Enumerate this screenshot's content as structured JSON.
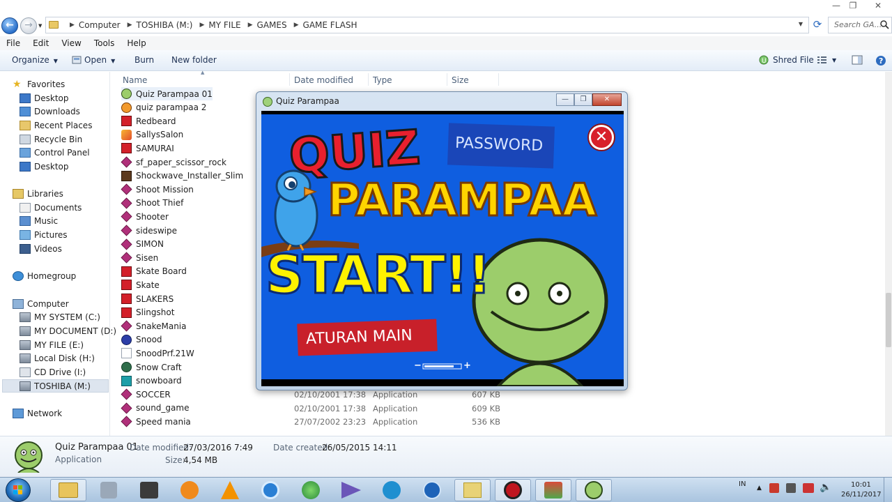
{
  "window": {
    "minimize": "—",
    "restore": "❐",
    "close": "✕"
  },
  "address": {
    "crumbs": [
      "Computer",
      "TOSHIBA (M:)",
      "MY FILE",
      "GAMES",
      "GAME FLASH"
    ],
    "search_placeholder": "Search GA..."
  },
  "menu": [
    "File",
    "Edit",
    "View",
    "Tools",
    "Help"
  ],
  "toolbar": {
    "organize": "Organize",
    "open": "Open",
    "burn": "Burn",
    "new_folder": "New folder",
    "shred": "Shred File"
  },
  "nav": {
    "favorites": "Favorites",
    "fav_items": [
      "Desktop",
      "Downloads",
      "Recent Places",
      "Recycle Bin",
      "Control Panel",
      "Desktop"
    ],
    "libraries": "Libraries",
    "lib_items": [
      "Documents",
      "Music",
      "Pictures",
      "Videos"
    ],
    "homegroup": "Homegroup",
    "computer": "Computer",
    "drives": [
      "MY SYSTEM (C:)",
      "MY DOCUMENT (D:)",
      "MY FILE (E:)",
      "Local Disk (H:)",
      "CD Drive (I:)",
      "TOSHIBA (M:)"
    ],
    "network": "Network"
  },
  "columns": {
    "name": "Name",
    "date": "Date modified",
    "type": "Type",
    "size": "Size"
  },
  "files": [
    {
      "name": "Quiz Parampaa 01",
      "icon": "green-face"
    },
    {
      "name": "quiz parampaa 2",
      "icon": "orange-face"
    },
    {
      "name": "Redbeard",
      "icon": "red-m"
    },
    {
      "name": "SallysSalon",
      "icon": "flash"
    },
    {
      "name": "SAMURAI",
      "icon": "red-m"
    },
    {
      "name": "sf_paper_scissor_rock",
      "icon": "diamond"
    },
    {
      "name": "Shockwave_Installer_Slim",
      "icon": "shockwave"
    },
    {
      "name": "Shoot Mission",
      "icon": "diamond"
    },
    {
      "name": "Shoot Thief",
      "icon": "diamond"
    },
    {
      "name": "Shooter",
      "icon": "diamond"
    },
    {
      "name": "sideswipe",
      "icon": "diamond"
    },
    {
      "name": "SIMON",
      "icon": "diamond"
    },
    {
      "name": "Sisen",
      "icon": "diamond"
    },
    {
      "name": "Skate Board",
      "icon": "red-m"
    },
    {
      "name": "Skate",
      "icon": "red-m"
    },
    {
      "name": "SLAKERS",
      "icon": "red-m"
    },
    {
      "name": "Slingshot",
      "icon": "red-m"
    },
    {
      "name": "SnakeMania",
      "icon": "diamond"
    },
    {
      "name": "Snood",
      "icon": "snood"
    },
    {
      "name": "SnoodPrf.21W",
      "icon": "blank"
    },
    {
      "name": "Snow Craft",
      "icon": "snow"
    },
    {
      "name": "snowboard",
      "icon": "teal"
    },
    {
      "name": "SOCCER",
      "icon": "diamond",
      "date": "02/10/2001 17:38",
      "type": "Application",
      "size": "607 KB"
    },
    {
      "name": "sound_game",
      "icon": "diamond",
      "date": "02/10/2001 17:38",
      "type": "Application",
      "size": "609 KB"
    },
    {
      "name": "Speed mania",
      "icon": "diamond",
      "date": "27/07/2002 23:23",
      "type": "Application",
      "size": "536 KB"
    }
  ],
  "details": {
    "name": "Quiz Parampaa 01",
    "kind": "Application",
    "date_modified_label": "Date modified:",
    "date_modified": "27/03/2016 7:49",
    "date_created_label": "Date created:",
    "date_created": "26/05/2015 14:11",
    "size_label": "Size:",
    "size": "4,54 MB"
  },
  "game": {
    "window_title": "Quiz Parampaa",
    "title_line1": "QUIZ",
    "title_line2": "PARAMPAA",
    "password_button": "PASSWORD",
    "start_button": "START!!",
    "rules_button": "ATURAN MAIN",
    "volume_minus": "−",
    "volume_plus": "+"
  },
  "tray": {
    "lang": "IN",
    "time": "10:01",
    "date": "26/11/2017"
  },
  "colors": {
    "game_blue": "#0f5ee0",
    "title_red": "#e8202e",
    "title_yellow": "#ffd400",
    "rules_red": "#c8202a",
    "face_green": "#9ccd6b"
  }
}
